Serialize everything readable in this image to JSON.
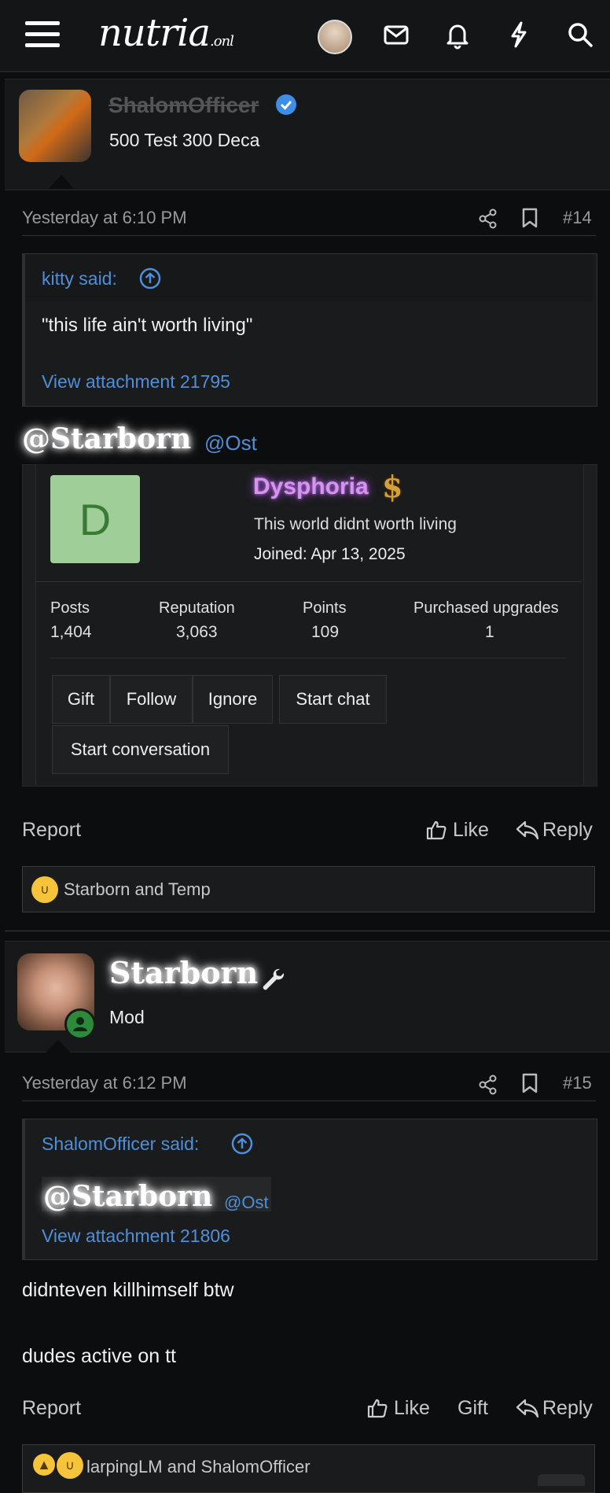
{
  "header": {
    "logo": "nutria",
    "logo_suffix": ".onl"
  },
  "post14": {
    "username": "ShalomOfficer",
    "user_title": "500 Test 300 Deca",
    "time": "Yesterday at 6:10 PM",
    "number": "#14",
    "quote": {
      "author": "kitty said:",
      "text": "\"this life ain't worth living\"",
      "attachment": "View attachment 21795"
    },
    "mention1": "@Starborn",
    "mention2": "@Ost",
    "card": {
      "initial": "D",
      "name": "Dysphoria",
      "badge": "$",
      "status": "This world didnt worth living",
      "joined": "Joined: Apr 13, 2025",
      "stats": [
        {
          "label": "Posts",
          "value": "1,404"
        },
        {
          "label": "Reputation",
          "value": "3,063"
        },
        {
          "label": "Points",
          "value": "109"
        },
        {
          "label": "Purchased upgrades",
          "value": "1"
        }
      ],
      "buttons": {
        "gift": "Gift",
        "follow": "Follow",
        "ignore": "Ignore",
        "start_chat": "Start chat",
        "start_conversation": "Start conversation"
      }
    },
    "actions": {
      "report": "Report",
      "like": "Like",
      "reply": "Reply"
    },
    "reactions": "Starborn and Temp"
  },
  "post15": {
    "username": "Starborn",
    "user_title": "Mod",
    "time": "Yesterday at 6:12 PM",
    "number": "#15",
    "quote": {
      "author": "ShalomOfficer said:",
      "mention1": "@Starborn",
      "mention2": "@Ost",
      "attachment": "View attachment 21806"
    },
    "lines": [
      "didnteven killhimself btw",
      "dudes active on tt"
    ],
    "actions": {
      "report": "Report",
      "like": "Like",
      "gift": "Gift",
      "reply": "Reply"
    },
    "reactions": "larpingLM and ShalomOfficer"
  },
  "colors": {
    "accent": "#4f8fda",
    "verified": "#3e8ee8",
    "online": "#3aa64a",
    "avatar_d": "#9fce98"
  }
}
